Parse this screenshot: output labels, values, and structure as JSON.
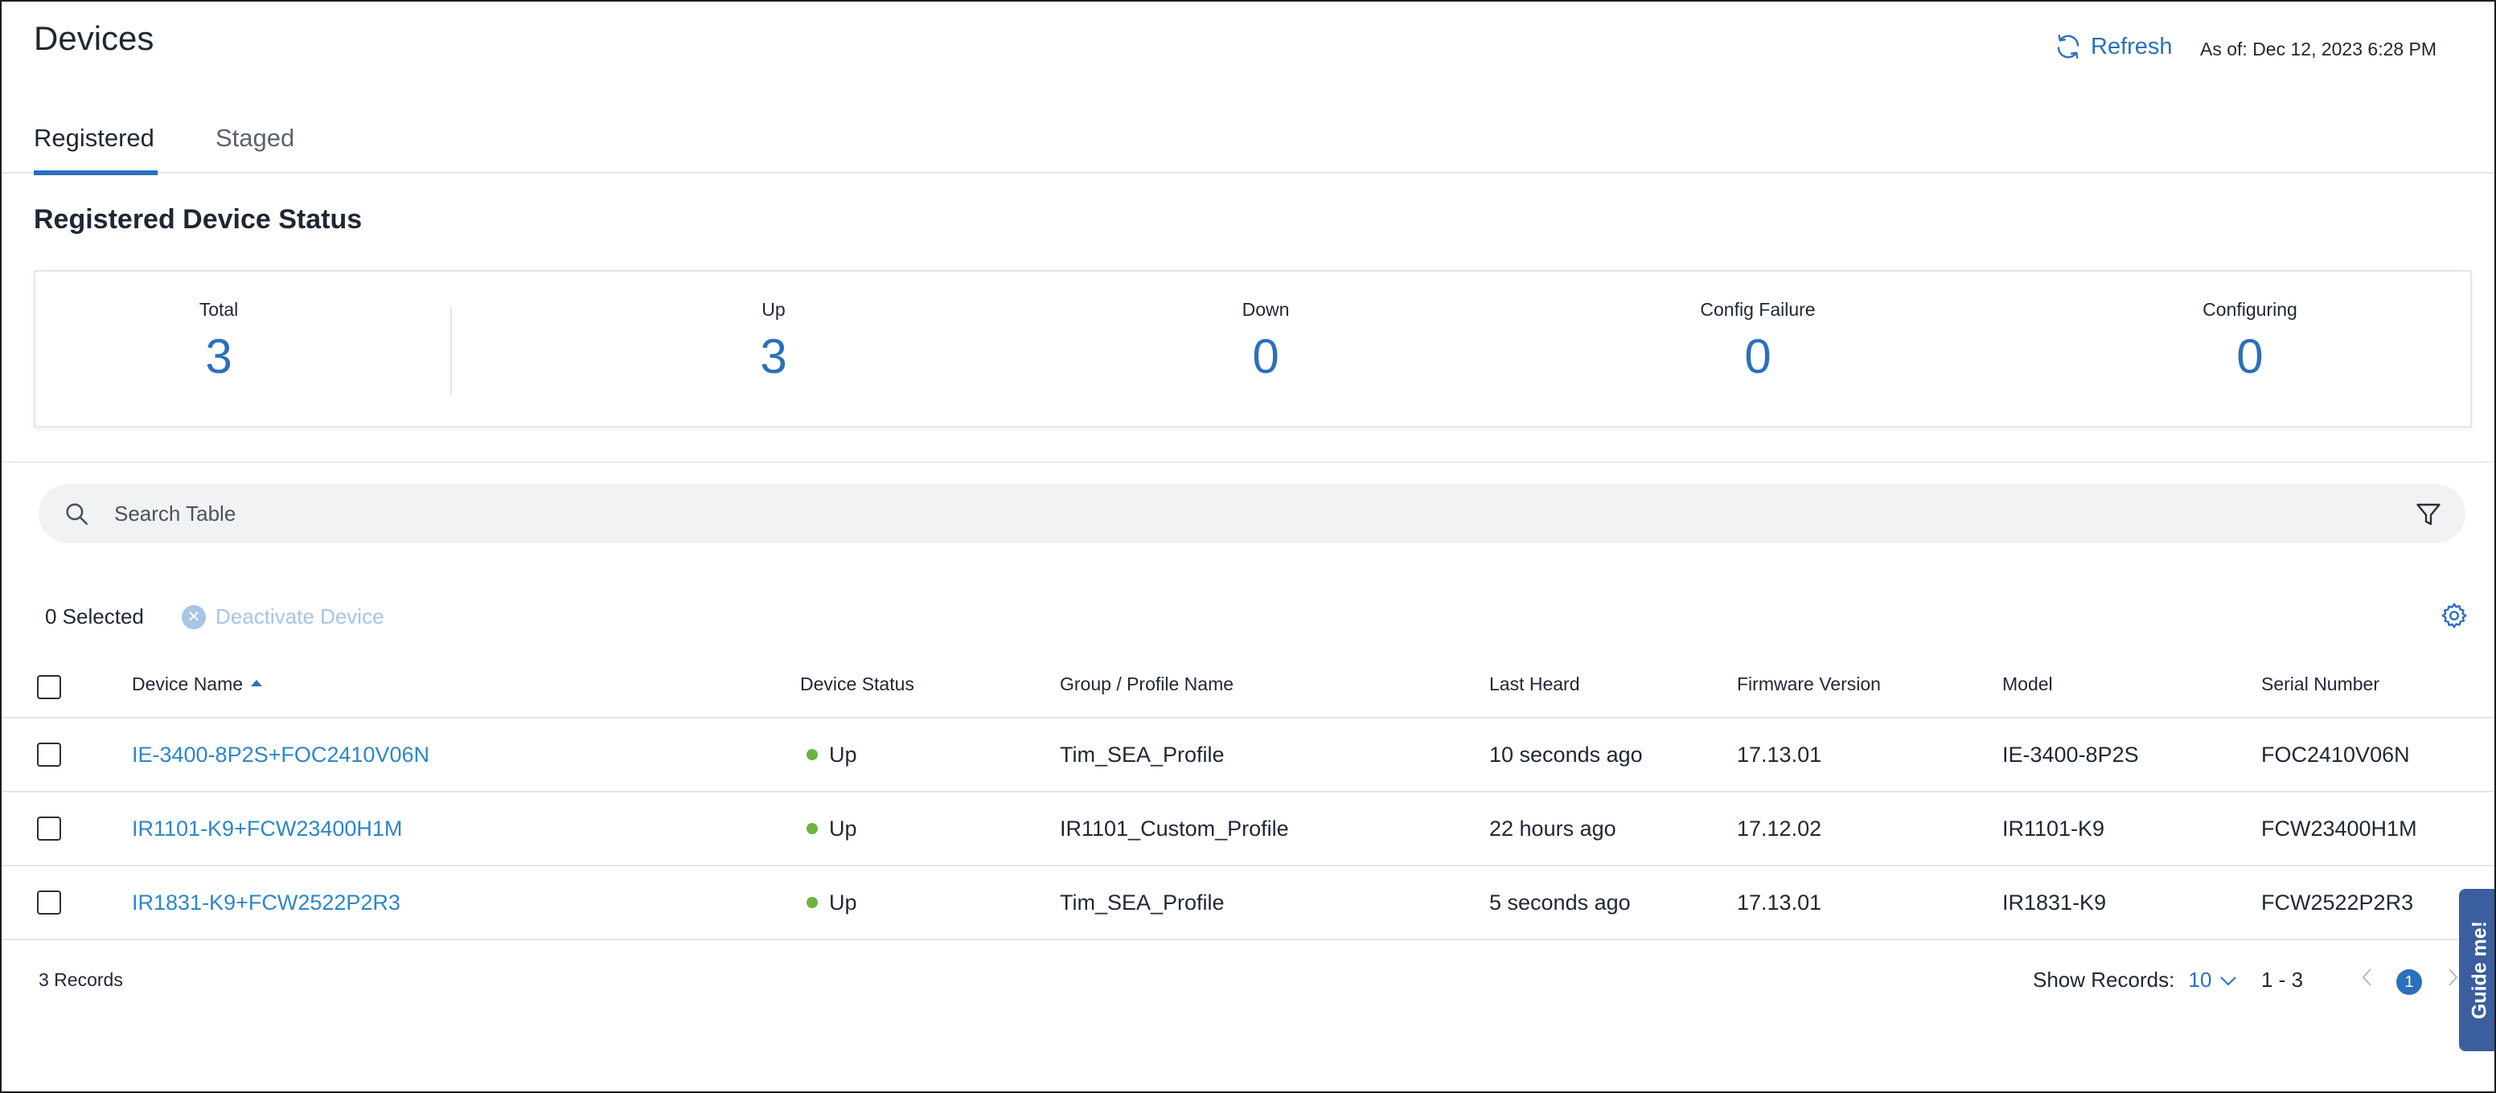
{
  "header": {
    "title": "Devices",
    "refresh_label": "Refresh",
    "as_of": "As of: Dec 12, 2023 6:28 PM"
  },
  "tabs": [
    {
      "label": "Registered",
      "active": true
    },
    {
      "label": "Staged",
      "active": false
    }
  ],
  "status": {
    "title": "Registered Device Status",
    "items": [
      {
        "label": "Total",
        "value": "3"
      },
      {
        "label": "Up",
        "value": "3"
      },
      {
        "label": "Down",
        "value": "0"
      },
      {
        "label": "Config Failure",
        "value": "0"
      },
      {
        "label": "Configuring",
        "value": "0"
      }
    ]
  },
  "search": {
    "placeholder": "Search Table",
    "value": ""
  },
  "toolbar": {
    "selected": "0 Selected",
    "deactivate_label": "Deactivate Device",
    "deactivate_icon": "x-circle-icon",
    "settings_icon": "gear-icon"
  },
  "table": {
    "columns": [
      "Device Name",
      "Device Status",
      "Group / Profile Name",
      "Last Heard",
      "Firmware Version",
      "Model",
      "Serial Number"
    ],
    "sort_column": "Device Name",
    "rows": [
      {
        "device_name": "IE-3400-8P2S+FOC2410V06N",
        "status": "Up",
        "group": "Tim_SEA_Profile",
        "last_heard": "10 seconds ago",
        "firmware": "17.13.01",
        "model": "IE-3400-8P2S",
        "serial": "FOC2410V06N"
      },
      {
        "device_name": "IR1101-K9+FCW23400H1M",
        "status": "Up",
        "group": "IR1101_Custom_Profile",
        "last_heard": "22 hours ago",
        "firmware": "17.12.02",
        "model": "IR1101-K9",
        "serial": "FCW23400H1M"
      },
      {
        "device_name": "IR1831-K9+FCW2522P2R3",
        "status": "Up",
        "group": "Tim_SEA_Profile",
        "last_heard": "5 seconds ago",
        "firmware": "17.13.01",
        "model": "IR1831-K9",
        "serial": "FCW2522P2R3"
      }
    ]
  },
  "footer": {
    "records": "3 Records",
    "show_records_label": "Show Records:",
    "show_records_value": "10",
    "range": "1 - 3",
    "current_page": "1"
  },
  "guide": {
    "label": "Guide me!"
  },
  "colors": {
    "accent": "#2c6fbb",
    "link": "#2c86c9",
    "status_up": "#6eb33f",
    "guide_bg": "#3b5f9e"
  }
}
